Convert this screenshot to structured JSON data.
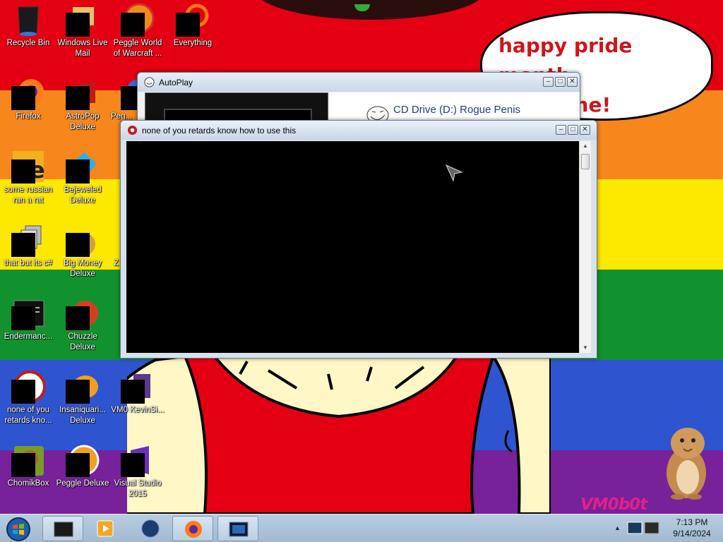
{
  "wallpaper": {
    "bands": [
      "#e40012",
      "#f7861c",
      "#fde800",
      "#12922e",
      "#2f54cf",
      "#77219a"
    ],
    "speech_bubble": {
      "line1": "happy pride month",
      "line2": "everyone!"
    },
    "watermark": "VM0b0t"
  },
  "desktop_icons": [
    {
      "label": "Recycle Bin",
      "icon": "recycle-bin-icon"
    },
    {
      "label": "Windows Live Mail",
      "icon": "mail-icon"
    },
    {
      "label": "Peggle World of Warcraft ...",
      "icon": "peggle-icon"
    },
    {
      "label": "Everything",
      "icon": "search-icon"
    },
    {
      "label": "Firefox",
      "icon": "firefox-icon"
    },
    {
      "label": "AstroPop Deluxe",
      "icon": "astropop-icon"
    },
    {
      "label": "Peg...",
      "icon": "peggle-icon"
    },
    {
      "label": "some russian ran a rat",
      "icon": "app-icon"
    },
    {
      "label": "Bejeweled Deluxe",
      "icon": "bejeweled-icon"
    },
    {
      "label": "that but its c#",
      "icon": "folder-stack-icon"
    },
    {
      "label": "Big Money Deluxe",
      "icon": "money-bag-icon"
    },
    {
      "label": "Z...",
      "icon": "app-icon"
    },
    {
      "label": "Endermanc...",
      "icon": "console-icon"
    },
    {
      "label": "Chuzzle Deluxe",
      "icon": "chuzzle-icon"
    },
    {
      "label": "none of you retards kno...",
      "icon": "cd-icon"
    },
    {
      "label": "Insaniquari... Deluxe",
      "icon": "fish-icon"
    },
    {
      "label": "VM0 KevinSi...",
      "icon": "file-icon"
    },
    {
      "label": "ChomikBox",
      "icon": "chomikbox-icon"
    },
    {
      "label": "Peggle Deluxe",
      "icon": "peggle-icon"
    },
    {
      "label": "Visual Studio 2015",
      "icon": "visual-studio-icon"
    }
  ],
  "autoplay": {
    "title": "AutoPlay",
    "drive_label": "CD Drive (D:) Rogue Penis"
  },
  "console": {
    "title": "none of you retards know how to use this"
  },
  "taskbar": {
    "buttons": [
      "console-window-icon",
      "media-player-icon",
      "globe-icon",
      "firefox-icon",
      "display-icon"
    ],
    "clock": {
      "time": "7:13 PM",
      "date": "9/14/2024"
    }
  }
}
